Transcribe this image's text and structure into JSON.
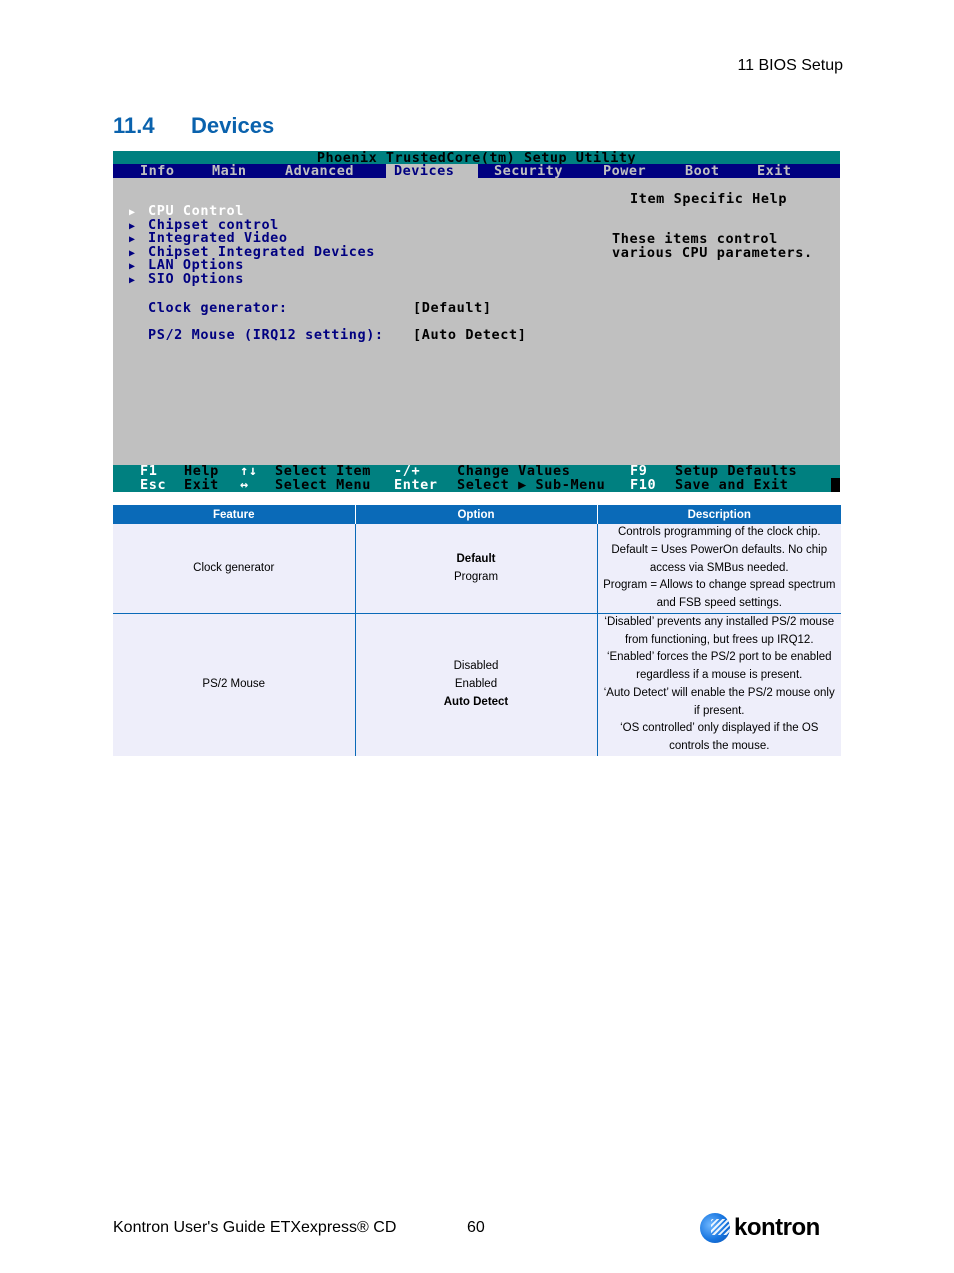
{
  "header": {
    "running_head": "11 BIOS Setup"
  },
  "section": {
    "number": "11.4",
    "title": "Devices"
  },
  "bios": {
    "title": "Phoenix TrustedCore(tm) Setup Utility",
    "tabs": [
      {
        "label": "Info"
      },
      {
        "label": "Main"
      },
      {
        "label": "Advanced"
      },
      {
        "label": "Devices",
        "active": true
      },
      {
        "label": "Security"
      },
      {
        "label": "Power"
      },
      {
        "label": "Boot"
      },
      {
        "label": "Exit"
      }
    ],
    "submenus": [
      {
        "label": "CPU Control",
        "selected": true
      },
      {
        "label": "Chipset control"
      },
      {
        "label": "Integrated Video"
      },
      {
        "label": "Chipset Integrated Devices"
      },
      {
        "label": "LAN Options"
      },
      {
        "label": "SIO Options"
      }
    ],
    "submenu_arrow": "▶",
    "settings": [
      {
        "label": "Clock generator:",
        "value": "[Default]"
      },
      {
        "label": "PS/2 Mouse (IRQ12 setting):",
        "value": "[Auto Detect]"
      }
    ],
    "help": {
      "title": "Item Specific Help",
      "text": "These items control\nvarious CPU parameters."
    },
    "footer_keys": {
      "row1": [
        {
          "key": "F1",
          "desc": "Help"
        },
        {
          "key": "↑↓",
          "desc": "Select Item"
        },
        {
          "key": "-/+",
          "desc": "Change Values"
        },
        {
          "key": "F9",
          "desc": "Setup Defaults"
        }
      ],
      "row2": [
        {
          "key": "Esc",
          "desc": "Exit"
        },
        {
          "key": "↔",
          "desc": "Select Menu"
        },
        {
          "key": "Enter",
          "desc": "Select ▶ Sub-Menu"
        },
        {
          "key": "F10",
          "desc": "Save and Exit"
        }
      ]
    },
    "colors": {
      "title_bg": "#008080",
      "menubar_bg": "#000080",
      "body_bg": "#c0c0c0",
      "item_text": "#000080"
    }
  },
  "table": {
    "headers": [
      "Feature",
      "Option",
      "Description"
    ],
    "rows": [
      {
        "feature": "Clock generator",
        "options": [
          {
            "label": "Default",
            "default": true
          },
          {
            "label": "Program"
          }
        ],
        "description": [
          "Controls programming of the clock chip.",
          "Default = Uses PowerOn defaults. No chip access via SMBus needed.",
          "Program = Allows to change spread spectrum and FSB speed settings."
        ]
      },
      {
        "feature": "PS/2 Mouse",
        "options": [
          {
            "label": "Disabled"
          },
          {
            "label": "Enabled"
          },
          {
            "label": "Auto Detect",
            "default": true
          }
        ],
        "description": [
          "‘Disabled’ prevents any installed PS/2 mouse from functioning, but frees up IRQ12.",
          "‘Enabled’ forces the PS/2 port to be enabled regardless if a mouse is present.",
          "‘Auto Detect’ will enable the PS/2 mouse only if present.",
          "‘OS controlled’ only displayed if the OS controls the mouse."
        ]
      }
    ]
  },
  "footer": {
    "doc_title": "Kontron User's Guide ETXexpress® CD",
    "page_number": "60",
    "logo_text": "kontron"
  }
}
